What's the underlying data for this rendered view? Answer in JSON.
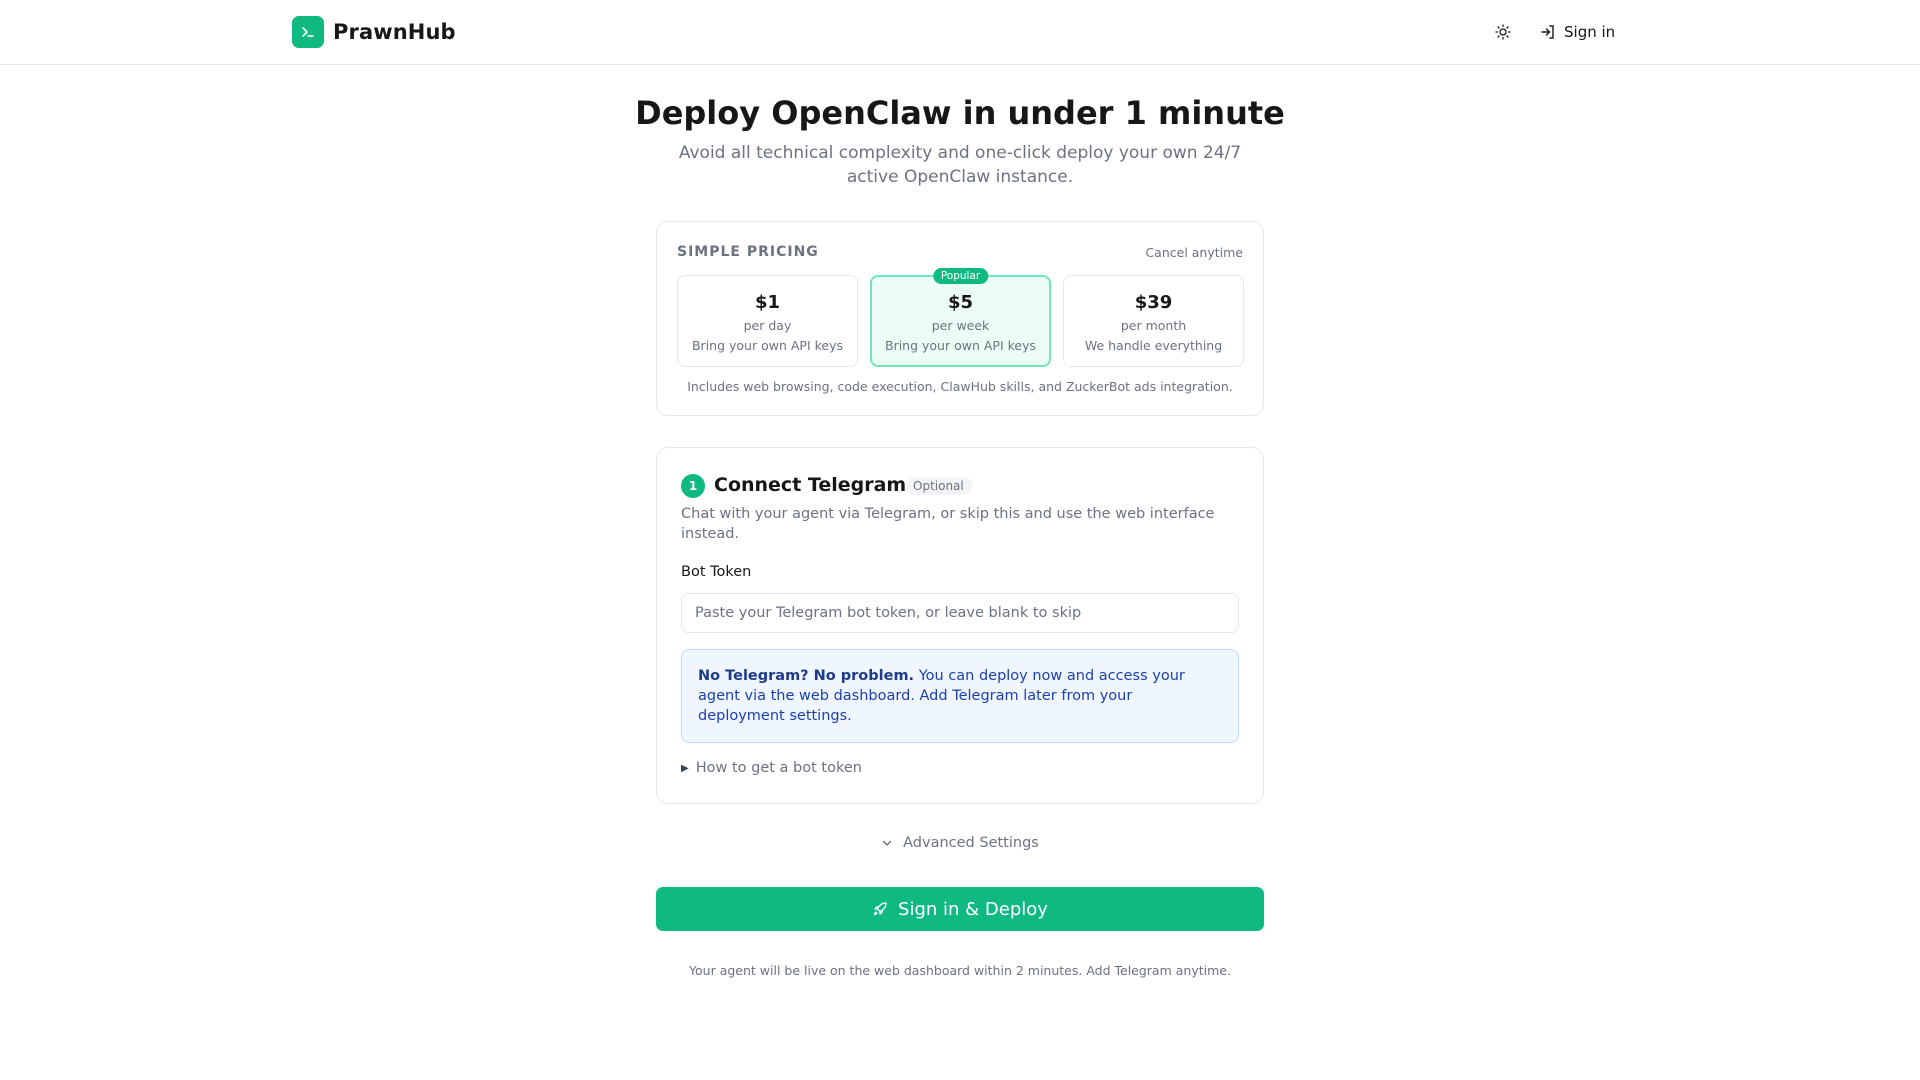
{
  "header": {
    "logo_text": "PrawnHub",
    "logo_icon": "terminal-icon",
    "theme_icon": "sun-icon",
    "signin_label": "Sign in",
    "signin_icon": "log-in-icon"
  },
  "hero": {
    "title": "Deploy OpenClaw in under 1 minute",
    "subtitle": "Avoid all technical complexity and one-click deploy your own 24/7 active OpenClaw instance."
  },
  "pricing": {
    "label": "SIMPLE PRICING",
    "cancel_text": "Cancel anytime",
    "plans": [
      {
        "price": "$1",
        "period": "per day",
        "description": "Bring your own API keys"
      },
      {
        "price": "$5",
        "period": "per week",
        "description": "Bring your own API keys",
        "badge": "Popular"
      },
      {
        "price": "$39",
        "period": "per month",
        "description": "We handle everything"
      }
    ],
    "note": "Includes web browsing, code execution, ClawHub skills, and ZuckerBot ads integration."
  },
  "telegram": {
    "step_number": "1",
    "title": "Connect Telegram",
    "optional_badge": "Optional",
    "description": "Chat with your agent via Telegram, or skip this and use the web interface instead.",
    "bot_token_label": "Bot Token",
    "bot_token_value": "",
    "bot_token_placeholder": "Paste your Telegram bot token, or leave blank to skip",
    "info_bold": "No Telegram? No problem.",
    "info_text": "You can deploy now and access your agent via the web dashboard. Add Telegram later from your deployment settings.",
    "howto_label": "How to get a bot token"
  },
  "advanced": {
    "label": "Advanced Settings",
    "icon": "chevron-down-icon"
  },
  "deploy": {
    "label": "Sign in & Deploy",
    "icon": "rocket-icon",
    "footnote": "Your agent will be live on the web dashboard within 2 minutes. Add Telegram anytime."
  },
  "colors": {
    "accent": "#10b981",
    "popular_bg": "#ecfdf5",
    "info_bg": "#eff6ff",
    "info_text": "#1e40af"
  }
}
